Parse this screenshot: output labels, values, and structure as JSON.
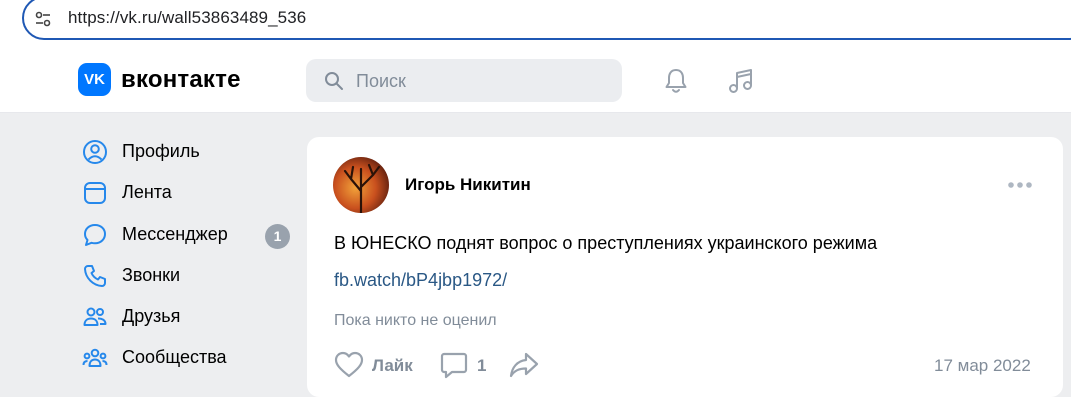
{
  "browser": {
    "url": "https://vk.ru/wall53863489_536",
    "site_info_icon": "tune-icon"
  },
  "header": {
    "logo_mark": "VK",
    "logo_text": "вконтакте",
    "search_placeholder": "Поиск",
    "icons": [
      "bell-icon",
      "music-icon"
    ]
  },
  "sidebar": {
    "items": [
      {
        "label": "Профиль",
        "icon": "profile-icon"
      },
      {
        "label": "Лента",
        "icon": "feed-icon"
      },
      {
        "label": "Мессенджер",
        "icon": "messenger-icon",
        "badge": "1"
      },
      {
        "label": "Звонки",
        "icon": "phone-icon"
      },
      {
        "label": "Друзья",
        "icon": "friends-icon"
      },
      {
        "label": "Сообщества",
        "icon": "communities-icon"
      }
    ]
  },
  "post": {
    "author": "Игорь Никитин",
    "text": "В ЮНЕСКО поднят вопрос о преступлениях украинского режима",
    "link": "fb.watch/bP4jbp1972/",
    "likes_note": "Пока никто не оценил",
    "like_label": "Лайк",
    "comments_count": "1",
    "date": "17 мар 2022"
  },
  "colors": {
    "brand": "#0077ff",
    "link": "#2a5885",
    "muted": "#818c99",
    "background": "#edeef0",
    "address_border": "#1f58b4"
  }
}
